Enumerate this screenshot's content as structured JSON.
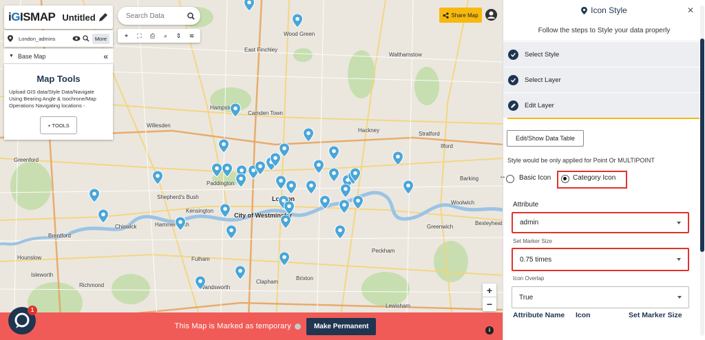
{
  "app": {
    "logo_prefix": "i",
    "logo_g": "G",
    "logo_rest": "ISMAP",
    "map_title": "Untitled ...",
    "edit_icon": "pencil-icon"
  },
  "layer": {
    "name": "London_admins",
    "more_label": "More",
    "icons": [
      "location-pin-icon",
      "eye-icon",
      "zoom-icon"
    ]
  },
  "basemap": {
    "label": "Base Map"
  },
  "map_tools": {
    "title": "Map Tools",
    "description": "Upload GIS data/Style Data/Navigate Using Bearing Angle & Isochrone/Map Operations Navigating locations -",
    "button_label": "+ TOOLS"
  },
  "search": {
    "placeholder": "Search Data"
  },
  "toolbar_icons": [
    "crosshair-icon",
    "fullscreen-icon",
    "print-icon",
    "search-icon",
    "measure-icon",
    "layers-icon"
  ],
  "share": {
    "label": "Share Map"
  },
  "map_labels": [
    {
      "text": "Wood Green",
      "cls": ""
    },
    {
      "text": "East Finchley",
      "cls": ""
    },
    {
      "text": "Walthamstow",
      "cls": ""
    },
    {
      "text": "Hampstead",
      "cls": ""
    },
    {
      "text": "Camden Town",
      "cls": ""
    },
    {
      "text": "Hackney",
      "cls": ""
    },
    {
      "text": "Stratford",
      "cls": ""
    },
    {
      "text": "Willesden",
      "cls": ""
    },
    {
      "text": "Greenford",
      "cls": ""
    },
    {
      "text": "Paddington",
      "cls": ""
    },
    {
      "text": "Shepherd's Bush",
      "cls": ""
    },
    {
      "text": "City of Westminster",
      "cls": "big"
    },
    {
      "text": "London",
      "cls": "big"
    },
    {
      "text": "Kensington",
      "cls": ""
    },
    {
      "text": "Chiswick",
      "cls": ""
    },
    {
      "text": "Hammersmith",
      "cls": ""
    },
    {
      "text": "Brentford",
      "cls": ""
    },
    {
      "text": "Fulham",
      "cls": ""
    },
    {
      "text": "Wandsworth",
      "cls": ""
    },
    {
      "text": "Clapham",
      "cls": ""
    },
    {
      "text": "Brixton",
      "cls": ""
    },
    {
      "text": "Peckham",
      "cls": ""
    },
    {
      "text": "Greenwich",
      "cls": ""
    },
    {
      "text": "Bexleyheath",
      "cls": ""
    },
    {
      "text": "Woolwich",
      "cls": ""
    },
    {
      "text": "Barking",
      "cls": ""
    },
    {
      "text": "Ilford",
      "cls": ""
    },
    {
      "text": "Lewisham",
      "cls": ""
    },
    {
      "text": "Richmond",
      "cls": ""
    },
    {
      "text": "Isleworth",
      "cls": ""
    },
    {
      "text": "Hounslow",
      "cls": ""
    }
  ],
  "temp_bar": {
    "message": "This Map is Marked as temporary",
    "button_label": "Make Permanent"
  },
  "chat": {
    "badge": "1"
  },
  "zoom": {
    "in": "+",
    "out": "−"
  },
  "panel": {
    "title": "Icon Style",
    "subtitle": "Follow the steps to Style your data properly",
    "steps": [
      {
        "label": "Select Style",
        "icon": "check-icon"
      },
      {
        "label": "Select Layer",
        "icon": "check-icon"
      },
      {
        "label": "Edit Layer",
        "icon": "pencil-icon"
      }
    ],
    "edit_table_label": "Edit/Show Data Table",
    "applied_note": "Style would be only applied for Point Or MULTIPOINT",
    "radio_basic": "Basic Icon",
    "radio_category": "Category Icon",
    "attribute_label": "Attribute",
    "attribute_value": "admin",
    "marker_size_label": "Set Marker Size",
    "marker_size_value": "0.75 times",
    "overlap_label": "Icon Overlap",
    "overlap_value": "True",
    "table_headers": [
      "Attribute Name",
      "Icon",
      "Set Marker Size"
    ]
  },
  "colors": {
    "navy": "#1f3550",
    "pin": "#4aa6d9",
    "temp_bar": "#f05b57",
    "accent": "#f7b90d",
    "highlight": "#e0312b"
  }
}
